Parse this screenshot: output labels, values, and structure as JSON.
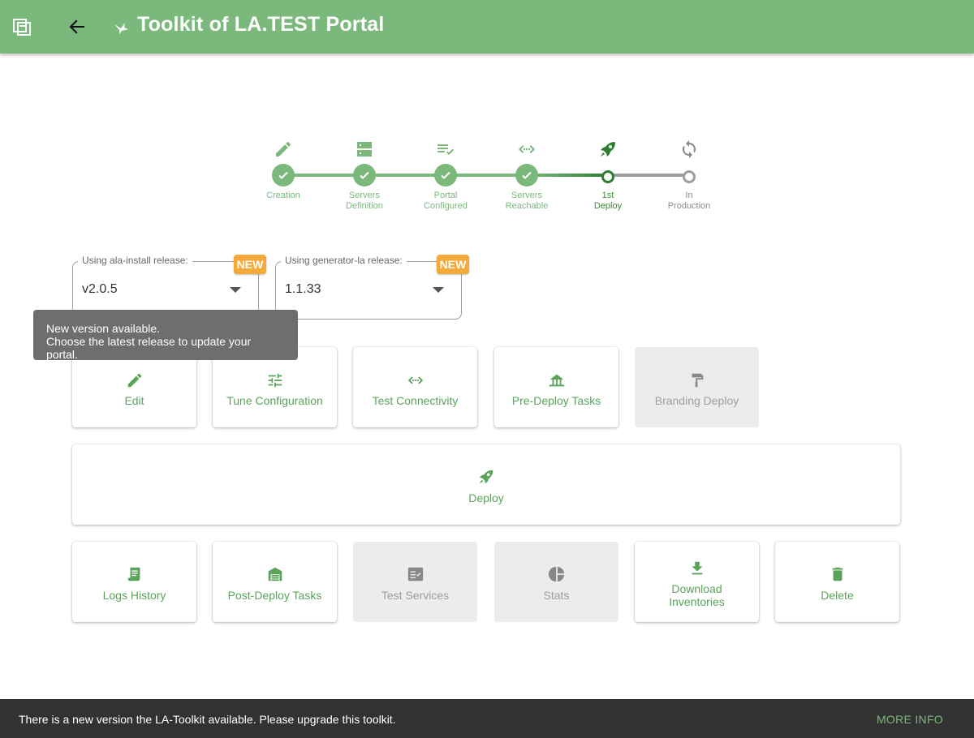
{
  "appbar": {
    "title": "Toolkit of LA.TEST Portal"
  },
  "stepper": [
    {
      "icon": "pencil-icon",
      "label_line1": "Creation",
      "label_line2": "",
      "state": "done"
    },
    {
      "icon": "server-icon",
      "label_line1": "Servers",
      "label_line2": "Definition",
      "state": "done"
    },
    {
      "icon": "playlist-check-icon",
      "label_line1": "Portal",
      "label_line2": "Configured",
      "state": "done"
    },
    {
      "icon": "code-arrows-icon",
      "label_line1": "Servers",
      "label_line2": "Reachable",
      "state": "done"
    },
    {
      "icon": "rocket-icon",
      "label_line1": "1st",
      "label_line2": "Deploy",
      "state": "current"
    },
    {
      "icon": "sync-icon",
      "label_line1": "In",
      "label_line2": "Production",
      "state": "pending"
    }
  ],
  "releases": {
    "ala_install": {
      "label": "Using ala-install release:",
      "value": "v2.0.5",
      "badge": "NEW"
    },
    "generator": {
      "label": "Using generator-la release:",
      "value": "1.1.33",
      "badge": "NEW"
    }
  },
  "tooltip": {
    "line1": "New version available.",
    "line2": "Choose the latest release to update your portal."
  },
  "actions_row1": [
    {
      "label": "Edit",
      "icon": "pencil-icon",
      "disabled": false
    },
    {
      "label": "Tune Configuration",
      "icon": "tune-icon",
      "disabled": false
    },
    {
      "label": "Test Connectivity",
      "icon": "code-arrows-icon",
      "disabled": false
    },
    {
      "label": "Pre-Deploy Tasks",
      "icon": "bridge-icon",
      "disabled": false
    },
    {
      "label": "Branding Deploy",
      "icon": "paint-roller-icon",
      "disabled": true
    }
  ],
  "deploy": {
    "label": "Deploy",
    "icon": "rocket-icon"
  },
  "actions_row3": [
    {
      "label": "Logs History",
      "icon": "script-icon",
      "disabled": false
    },
    {
      "label": "Post-Deploy Tasks",
      "icon": "warehouse-icon",
      "disabled": false
    },
    {
      "label": "Test Services",
      "icon": "checklist-icon",
      "disabled": true
    },
    {
      "label": "Stats",
      "icon": "chart-pie-icon",
      "disabled": true
    },
    {
      "label_line1": "Download",
      "label_line2": "Inventories",
      "icon": "download-icon",
      "disabled": false
    },
    {
      "label": "Delete",
      "icon": "trash-icon",
      "disabled": false
    }
  ],
  "snackbar": {
    "message": "There is a new version the LA-Toolkit available. Please upgrade this toolkit.",
    "action": "MORE INFO"
  },
  "colors": {
    "primary": "#7bb87b",
    "current_step": "#2e7d32",
    "badge": "#f5a93b",
    "snackbar": "#323232"
  }
}
